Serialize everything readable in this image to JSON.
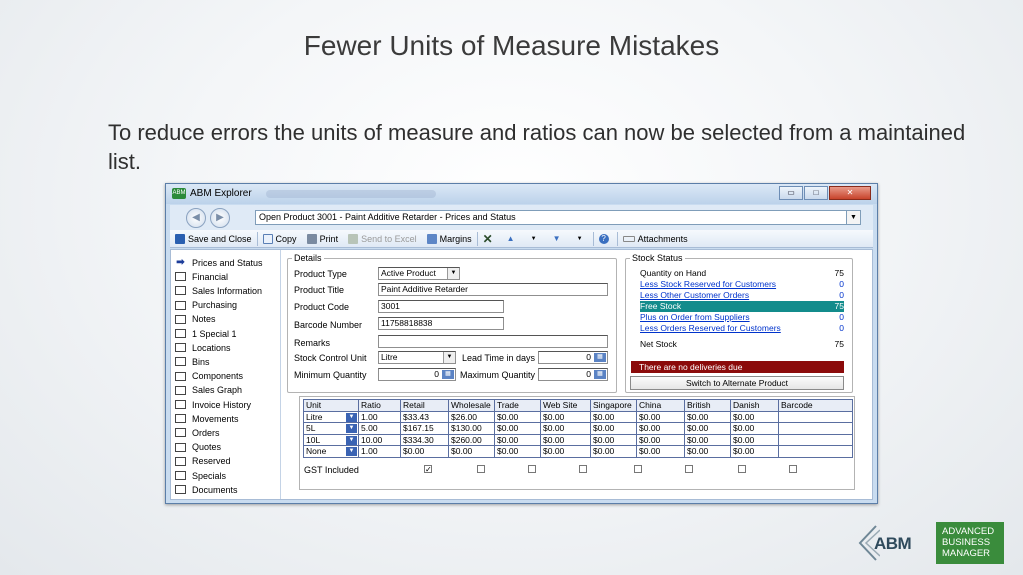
{
  "slide": {
    "title": "Fewer Units of Measure Mistakes",
    "body": "To reduce errors the units of measure and ratios can now be selected from a maintained list."
  },
  "window": {
    "logo_text": "ABM",
    "title": "ABM Explorer",
    "controls": {
      "minimize": "▭",
      "maximize": "□",
      "close": "✕"
    }
  },
  "nav": {
    "back": "◀",
    "forward": "▶",
    "address": "Open Product 3001 - Paint Additive Retarder - Prices and Status",
    "dropdown": "▼"
  },
  "toolbar": {
    "save": "Save and Close",
    "copy": "Copy",
    "print": "Print",
    "send_to_excel": "Send to Excel",
    "margins": "Margins",
    "delete": "✕",
    "up": "▲",
    "up_menu": "▼",
    "down": "▼",
    "down_menu": "▼",
    "help": "?",
    "attachments": "Attachments"
  },
  "sidebar": {
    "items": [
      "Prices and Status",
      "Financial",
      "Sales Information",
      "Purchasing",
      "Notes",
      "1 Special 1",
      "Locations",
      "Bins",
      "Components",
      "Sales Graph",
      "Invoice History",
      "Movements",
      "Orders",
      "Quotes",
      "Reserved",
      "Specials",
      "Documents"
    ]
  },
  "details": {
    "group_label": "Details",
    "product_type_label": "Product Type",
    "product_type_value": "Active Product",
    "product_title_label": "Product Title",
    "product_title_value": "Paint Additive Retarder",
    "product_code_label": "Product Code",
    "product_code_value": "3001",
    "barcode_label": "Barcode Number",
    "barcode_value": "11758818838",
    "remarks_label": "Remarks",
    "remarks_value": "",
    "stock_unit_label": "Stock Control Unit",
    "stock_unit_value": "Litre",
    "lead_time_label": "Lead Time in days",
    "lead_time_value": "0",
    "min_qty_label": "Minimum Quantity",
    "min_qty_value": "0",
    "max_qty_label": "Maximum Quantity",
    "max_qty_value": "0"
  },
  "stock": {
    "group_label": "Stock Status",
    "rows": [
      {
        "label": "Quantity on Hand",
        "value": "75"
      },
      {
        "label": "Less Stock Reserved for Customers",
        "value": "0"
      },
      {
        "label": "Less Other Customer Orders",
        "value": "0"
      },
      {
        "label": "Free Stock",
        "value": "75"
      },
      {
        "label": "Plus on Order from Suppliers",
        "value": "0"
      },
      {
        "label": "Less Orders Reserved for Customers",
        "value": "0"
      },
      {
        "label": "Net Stock",
        "value": "75"
      }
    ],
    "alert": "There are no deliveries due",
    "switch_button": "Switch to Alternate Product"
  },
  "grid": {
    "headers": [
      "Unit",
      "Ratio",
      "Retail",
      "Wholesale",
      "Trade",
      "Web Site",
      "Singapore",
      "China",
      "British",
      "Danish",
      "Barcode"
    ],
    "rows": [
      [
        "Litre",
        "1.00",
        "$33.43",
        "$26.00",
        "$0.00",
        "$0.00",
        "$0.00",
        "$0.00",
        "$0.00",
        "$0.00",
        ""
      ],
      [
        "5L",
        "5.00",
        "$167.15",
        "$130.00",
        "$0.00",
        "$0.00",
        "$0.00",
        "$0.00",
        "$0.00",
        "$0.00",
        ""
      ],
      [
        "10L",
        "10.00",
        "$334.30",
        "$260.00",
        "$0.00",
        "$0.00",
        "$0.00",
        "$0.00",
        "$0.00",
        "$0.00",
        ""
      ],
      [
        "None",
        "1.00",
        "$0.00",
        "$0.00",
        "$0.00",
        "$0.00",
        "$0.00",
        "$0.00",
        "$0.00",
        "$0.00",
        ""
      ]
    ],
    "gst_label": "GST Included",
    "gst_checks": [
      true,
      false,
      false,
      false,
      false,
      false,
      false,
      false
    ]
  },
  "logo": {
    "abm": "ABM",
    "line1": "ADVANCED",
    "line2": "BUSINESS",
    "line3": "MANAGER"
  },
  "colors": {
    "free_stock_highlight": "#138c8c",
    "alert_bg": "#8b0a0a",
    "brand_green": "#3a8c3c"
  }
}
